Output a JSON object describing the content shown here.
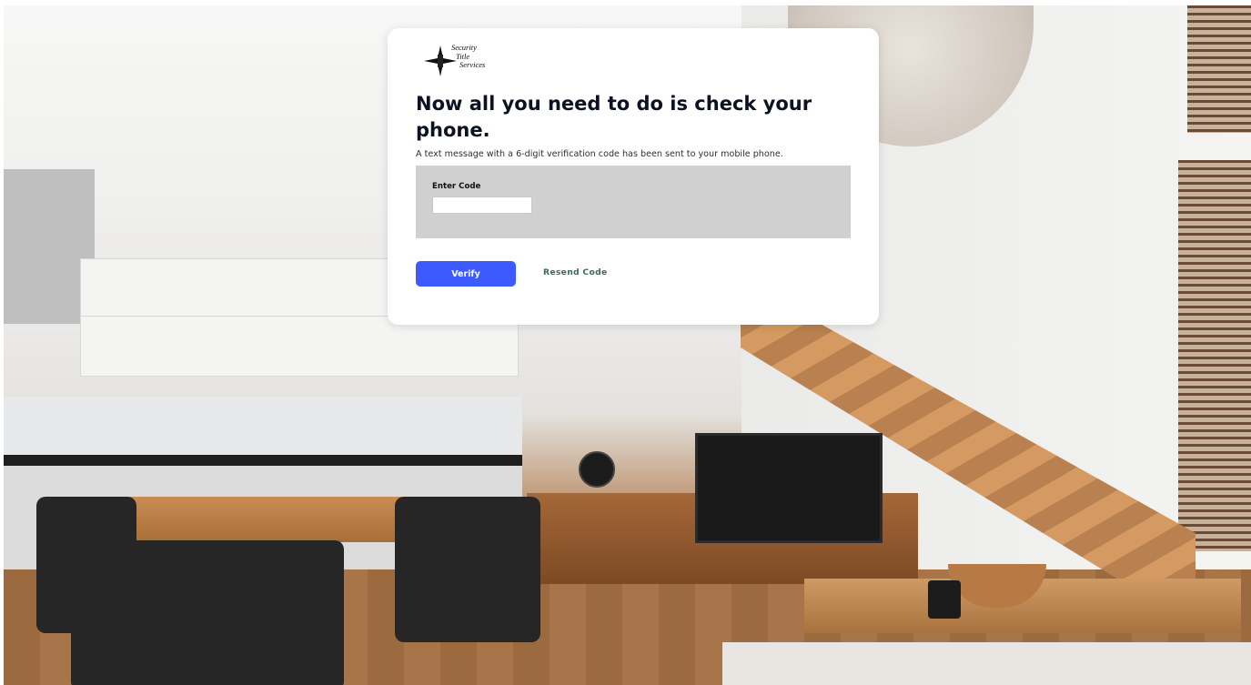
{
  "brand": {
    "logo_line1": "Security",
    "logo_line2": "Title",
    "logo_line3": "Services"
  },
  "verification": {
    "title": "Now all you need to do is check your phone.",
    "subtitle": "A text message with a 6-digit verification code has been sent to your mobile phone.",
    "code_label": "Enter Code",
    "code_value": "",
    "verify_label": "Verify",
    "resend_label": "Resend Code"
  },
  "colors": {
    "verify_button": "#3d5afe",
    "resend_link": "#3b6b5a",
    "panel": "#d0d0d0",
    "title_text": "#0c1222"
  }
}
